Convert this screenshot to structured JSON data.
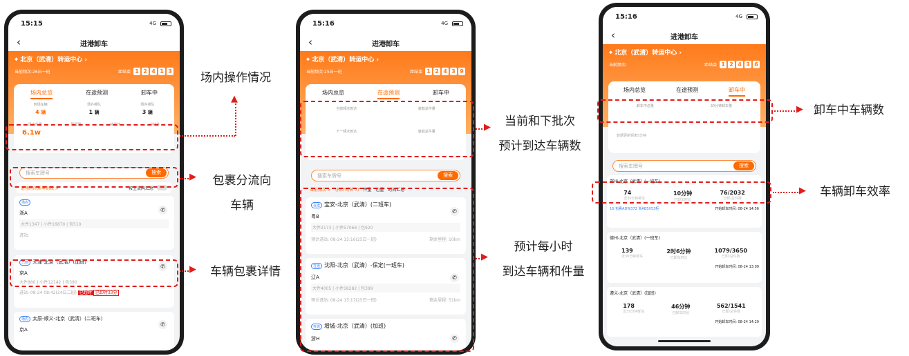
{
  "phone1": {
    "time": "15:15",
    "signal": "4G",
    "title": "进港卸车",
    "center": "北京（武清）转运中心",
    "batch": "当前频次:26日一班",
    "countdown_label": "距结束",
    "countdown": [
      "1",
      "2",
      "4",
      "1",
      "3"
    ],
    "tabs": [
      "场内总览",
      "在途预测",
      "卸车中"
    ],
    "stat_labels": [
      "到场车辆",
      "场外排队",
      "场内排队"
    ],
    "stat_values": [
      "4",
      "1",
      "3"
    ],
    "stat_unit": "辆",
    "metric_labels": [
      "场内件量",
      "残留量",
      "待操作",
      "中转件"
    ],
    "metric_value": "6.1w",
    "search_placeholder": "搜索车牌号",
    "search_btn": "搜索",
    "flow_link": "进场时间从早到晚 >",
    "flow_toggle": "按主流向汇总",
    "items": [
      {
        "tag": "场内",
        "route": "",
        "plate": "浙A",
        "info": "大件1347 | 小件16870 | 包510",
        "extra": "进站:"
      },
      {
        "tag": "已到",
        "route": "天津-北京（武清）(加班)",
        "plate": "京A",
        "info": "大件880 | 小件12142 | 包390",
        "extra": "进站: 08-24 08:42(24日二班)",
        "badges": [
          "已超时",
          "已卸时33分"
        ]
      },
      {
        "tag": "场内",
        "route": "太原-顺义-北京（武清）(二班车)",
        "plate": "京A",
        "info": "",
        "extra": ""
      }
    ]
  },
  "phone2": {
    "time": "15:16",
    "signal": "4G",
    "title": "进港卸车",
    "center": "北京（武清）转运中心",
    "batch": "当前频次:25日一班",
    "countdown_label": "距结束",
    "countdown": [
      "1",
      "2",
      "4",
      "3",
      "9"
    ],
    "tabs": [
      "场内总览",
      "在途预测",
      "卸车中"
    ],
    "pred_labels": [
      "当前频次到达",
      "装载总件量",
      "下一频次到达",
      "装载总件量"
    ],
    "search_placeholder": "搜索车牌号",
    "search_btn": "搜索",
    "filters": [
      "当前频次 >",
      "(预计时长 7)",
      "件量",
      "包量",
      "时间汇总"
    ],
    "items": [
      {
        "tag": "在途",
        "route": "宝安-北京（武清）(二班车)",
        "plate": "粤B",
        "info": "大件2173 | 小件57068 | 包920",
        "eta": "预计进站: 08-24 15:16(25日一班)",
        "dist": "剩余里程: 10km"
      },
      {
        "tag": "在途",
        "route": "沈阳-北京（武清）-保定(一班车)",
        "plate": "辽A",
        "info": "大件4005 | 小件18282 | 包399",
        "eta": "预计进站: 08-24 15:17(25日一班)",
        "dist": "剩余里程: 51km"
      },
      {
        "tag": "在途",
        "route": "增城-北京（武清）(加班)",
        "plate": "浙H",
        "info": "",
        "eta": "",
        "dist": ""
      }
    ]
  },
  "phone3": {
    "time": "15:16",
    "signal": "4G",
    "title": "进港卸车",
    "center": "北京（武清）转运中心",
    "batch": "当前频次:",
    "countdown_label": "距结束",
    "countdown": [
      "1",
      "2",
      "4",
      "3",
      "6"
    ],
    "tabs": [
      "场内总览",
      "在途预测",
      "卸车中"
    ],
    "unload_labels": [
      "卸车中总量",
      "30分钟卸车量"
    ],
    "note": "数据更新频率5分钟",
    "search_placeholder": "搜索车牌号",
    "search_btn": "搜索",
    "items": [
      {
        "route": "郑州-北京（武清）(一班车)",
        "v1": "74",
        "v2": "10分钟",
        "v3": "76/2032",
        "s1": "近30分钟卸车",
        "s2": "已卸车时长",
        "s3": "已卸/总件数",
        "foot": "16:包裹ADW372 浙AB5X53柜",
        "time": "开始卸车时间: 08-24 14:56"
      },
      {
        "route": "德州-北京（武清）(一班车)",
        "v1": "139",
        "v2": "2时6分钟",
        "v3": "1079/3650",
        "s1": "近30分钟卸车",
        "s2": "已卸车时长",
        "s3": "已卸/总件数",
        "foot": "",
        "time": "开始卸车时间: 08-24 13:09"
      },
      {
        "route": "遵义-北京（武清）(加班)",
        "v1": "178",
        "v2": "46分钟",
        "v3": "562/1541",
        "s1": "近30分钟卸车",
        "s2": "已卸车时长",
        "s3": "已卸/总件数",
        "foot": "",
        "time": "开始卸车时间: 08-24 14:29"
      }
    ]
  },
  "annotations": {
    "a1": "场内操作情况",
    "a2a": "包裹分流向",
    "a2b": "车辆",
    "a3": "车辆包裹详情",
    "a4a": "当前和下批次",
    "a4b": "预计到达车辆数",
    "a5a": "预计每小时",
    "a5b": "到达车辆和件量",
    "a6": "卸车中车辆数",
    "a7": "车辆卸车效率"
  }
}
